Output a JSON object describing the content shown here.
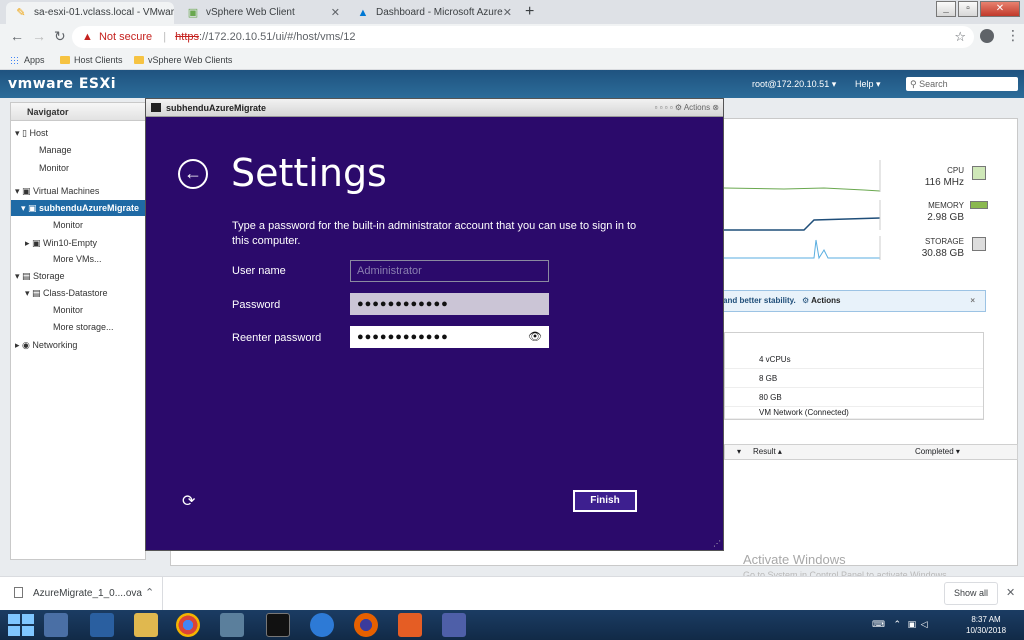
{
  "browser": {
    "tabs": [
      {
        "title": "sa-esxi-01.vclass.local - VMware ESXi",
        "active": true
      },
      {
        "title": "vSphere Web Client",
        "active": false
      },
      {
        "title": "Dashboard - Microsoft Azure",
        "active": false
      }
    ],
    "new_tab": "+",
    "window_controls": {
      "minimize": "_",
      "maximize": "▫",
      "close": "✕"
    },
    "address": {
      "warning": "▲",
      "not_secure": "Not secure",
      "scheme": "https",
      "rest": "://172.20.10.51/ui/#/host/vms/12"
    },
    "bookmarks": [
      "Apps",
      "Host Clients",
      "vSphere Web Clients"
    ]
  },
  "esxi": {
    "brand": "vmware ESXi",
    "user": "root@172.20.10.51 ▾",
    "help": "Help ▾",
    "search_placeholder": "Search",
    "navigator": {
      "title": "Navigator",
      "items": [
        {
          "label": "▾ ▯ Host",
          "level": 0
        },
        {
          "label": "Manage",
          "level": 2
        },
        {
          "label": "Monitor",
          "level": 2
        },
        {
          "label": "▾ ▣ Virtual Machines",
          "level": 0
        },
        {
          "label": "▾ ▣ subhenduAzureMigrate",
          "level": 1,
          "selected": true
        },
        {
          "label": "Monitor",
          "level": 3
        },
        {
          "label": "▸ ▣ Win10-Empty",
          "level": 1
        },
        {
          "label": "More VMs...",
          "level": 3
        },
        {
          "label": "▾ ▤ Storage",
          "level": 0
        },
        {
          "label": "▾ ▤ Class-Datastore",
          "level": 1
        },
        {
          "label": "Monitor",
          "level": 3
        },
        {
          "label": "More storage...",
          "level": 3
        },
        {
          "label": "▸ ◉ Networking",
          "level": 0
        }
      ]
    },
    "metrics": [
      {
        "label": "CPU",
        "value": "116 MHz"
      },
      {
        "label": "MEMORY",
        "value": "2.98 GB"
      },
      {
        "label": "STORAGE",
        "value": "30.88 GB"
      }
    ],
    "infobar": {
      "text": "and better stability.",
      "action": "Actions",
      "close": "×"
    },
    "hardware": [
      "4 vCPUs",
      "8 GB",
      "80 GB",
      "VM Network (Connected)"
    ],
    "tasks": {
      "result_header": "Result ▴",
      "completed_header": "Completed ▾"
    }
  },
  "console": {
    "title": "subhenduAzureMigrate",
    "actions": "Actions",
    "back_icon": "←",
    "heading": "Settings",
    "description": "Type a password for the built-in administrator account that you can use to sign in to this computer.",
    "fields": {
      "username_label": "User name",
      "username_placeholder": "Administrator",
      "password_label": "Password",
      "password_value": "●●●●●●●●●●●●",
      "reenter_label": "Reenter password",
      "reenter_value": "●●●●●●●●●●●●",
      "reveal_icon": "👁"
    },
    "finish_label": "Finish",
    "ease_icon": "⟳"
  },
  "watermark": {
    "title": "Activate Windows",
    "subtitle": "Go to System in Control Panel to activate Windows."
  },
  "downloads": {
    "file": "AzureMigrate_1_0....ova",
    "show_all": "Show all",
    "close": "✕"
  },
  "taskbar": {
    "time": "8:37 AM",
    "date": "10/30/2018"
  }
}
